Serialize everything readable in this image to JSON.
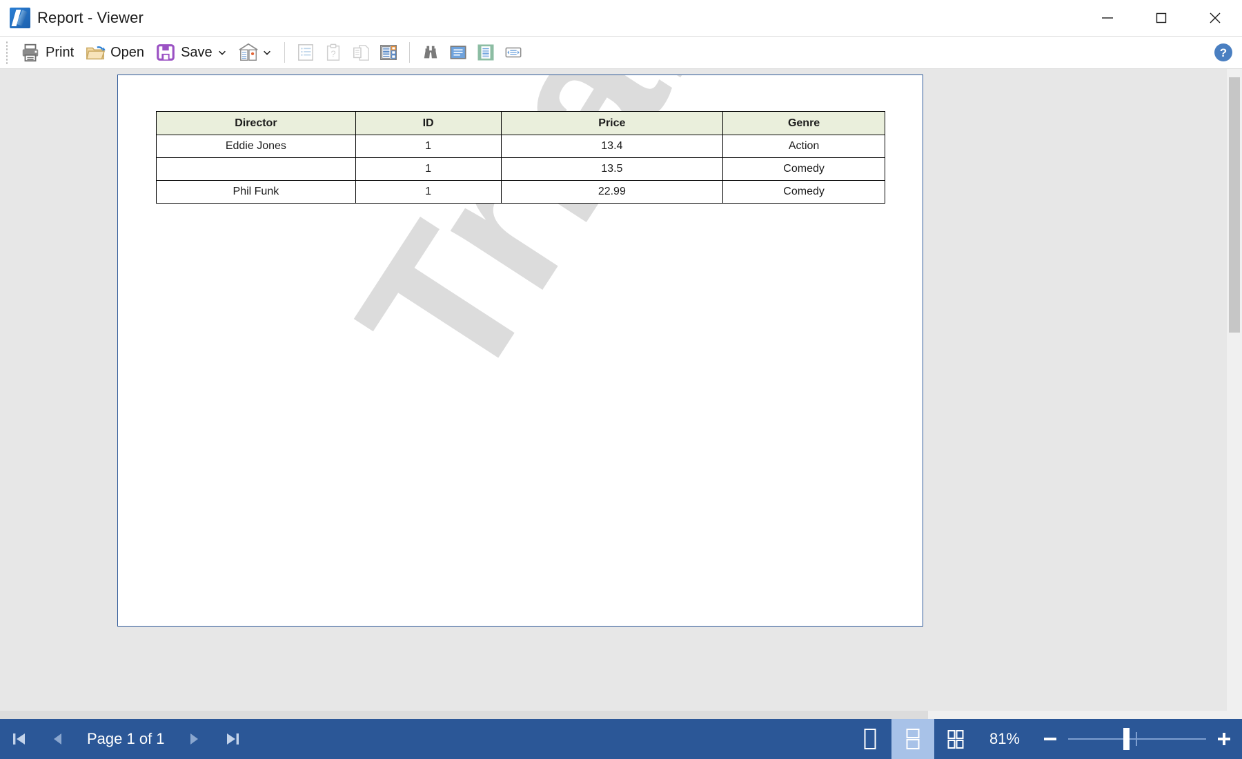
{
  "window": {
    "title": "Report - Viewer",
    "app_icon": "report-viewer-icon",
    "minimize": "minimize-icon",
    "maximize": "maximize-icon",
    "close": "close-icon"
  },
  "toolbar": {
    "print_label": "Print",
    "open_label": "Open",
    "save_label": "Save",
    "save_caret": "chevron-down-icon",
    "items": [
      {
        "name": "print-button",
        "icon": "printer-icon",
        "label": "Print"
      },
      {
        "name": "open-button",
        "icon": "folder-open-icon",
        "label": "Open"
      },
      {
        "name": "save-button",
        "icon": "floppy-disk-icon",
        "label": "Save"
      },
      {
        "name": "design-report-button",
        "icon": "report-design-icon",
        "label": ""
      },
      {
        "name": "bookmarks-button",
        "icon": "bookmarks-list-icon",
        "label": ""
      },
      {
        "name": "parameters-button",
        "icon": "parameters-clipboard-icon",
        "label": ""
      },
      {
        "name": "copy-page-button",
        "icon": "copy-page-icon",
        "label": ""
      },
      {
        "name": "thumbnails-button",
        "icon": "thumbnails-panel-icon",
        "label": ""
      },
      {
        "name": "find-button",
        "icon": "binoculars-find-icon",
        "label": ""
      },
      {
        "name": "page-view-button",
        "icon": "page-view-blue-icon",
        "label": ""
      },
      {
        "name": "fit-page-button",
        "icon": "fit-page-green-icon",
        "label": ""
      },
      {
        "name": "fit-width-button",
        "icon": "fit-width-icon",
        "label": ""
      }
    ],
    "help": "help-question-icon"
  },
  "document": {
    "watermark_text": "Trial",
    "table": {
      "headers": [
        "Director",
        "ID",
        "Price",
        "Genre"
      ],
      "rows": [
        [
          "Eddie Jones",
          "1",
          "13.4",
          "Action"
        ],
        [
          "",
          "1",
          "13.5",
          "Comedy"
        ],
        [
          "Phil Funk",
          "1",
          "22.99",
          "Comedy"
        ]
      ]
    }
  },
  "statusbar": {
    "first_page": "first-page-icon",
    "prev_page": "previous-page-icon",
    "page_label": "Page 1 of 1",
    "next_page": "next-page-icon",
    "last_page": "last-page-icon",
    "view_single": "single-page-view-icon",
    "view_continuous": "continuous-page-view-icon",
    "view_multi": "multi-page-view-icon",
    "zoom_percent": "81%",
    "zoom_out": "zoom-out-icon",
    "zoom_in": "zoom-in-icon",
    "slider_value": "81"
  },
  "colors": {
    "accent": "#2b5797",
    "table_header_bg": "#eaefdc",
    "canvas_bg": "#e7e7e7",
    "watermark": "#dcdcdc"
  }
}
